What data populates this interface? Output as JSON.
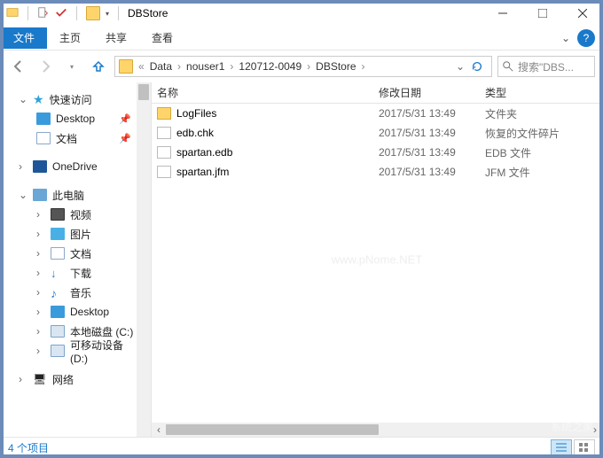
{
  "window": {
    "title": "DBStore"
  },
  "menu": {
    "file": "文件",
    "home": "主页",
    "share": "共享",
    "view": "查看"
  },
  "breadcrumb": {
    "parts": [
      "Data",
      "nouser1",
      "120712-0049",
      "DBStore"
    ]
  },
  "search": {
    "placeholder": "搜索\"DBS..."
  },
  "columns": {
    "name": "名称",
    "date": "修改日期",
    "type": "类型"
  },
  "tree": {
    "quick": "快速访问",
    "desktop": "Desktop",
    "documents": "文档",
    "onedrive": "OneDrive",
    "thispc": "此电脑",
    "videos": "视频",
    "pictures": "图片",
    "downloads": "下载",
    "music": "音乐",
    "cdrive": "本地磁盘 (C:)",
    "ddrive": "可移动设备 (D:)",
    "network": "网络"
  },
  "files": [
    {
      "name": "LogFiles",
      "date": "2017/5/31 13:49",
      "type": "文件夹",
      "icon": "folder"
    },
    {
      "name": "edb.chk",
      "date": "2017/5/31 13:49",
      "type": "恢复的文件碎片",
      "icon": "file"
    },
    {
      "name": "spartan.edb",
      "date": "2017/5/31 13:49",
      "type": "EDB 文件",
      "icon": "file"
    },
    {
      "name": "spartan.jfm",
      "date": "2017/5/31 13:49",
      "type": "JFM 文件",
      "icon": "file"
    }
  ],
  "status": {
    "count": "4 个项目"
  },
  "watermark": {
    "center": "www.pNome.NET",
    "corner": "系统之家"
  }
}
